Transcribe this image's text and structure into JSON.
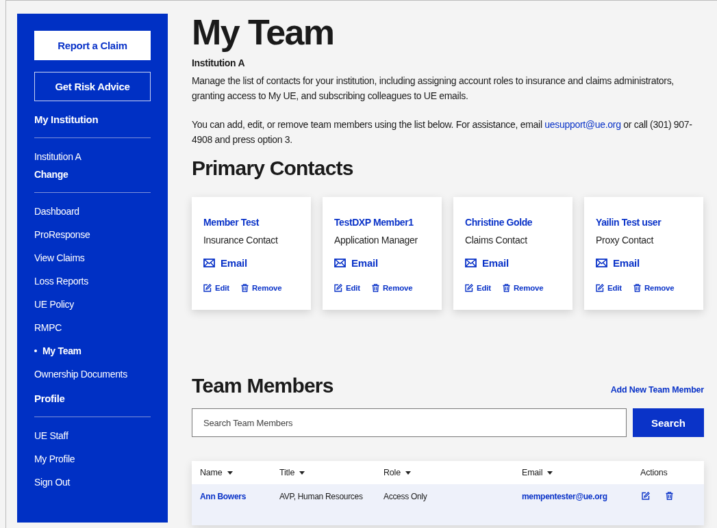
{
  "sidebar": {
    "buttons": [
      {
        "label": "Report a Claim",
        "kind": "filled"
      },
      {
        "label": "Get Risk Advice",
        "kind": "outline"
      }
    ],
    "institution_heading": "My Institution",
    "institution": {
      "name": "Institution A",
      "change_link": "Change"
    },
    "nav_items": [
      {
        "label": "Dashboard",
        "selected": false
      },
      {
        "label": "ProResponse",
        "selected": false
      },
      {
        "label": "View Claims",
        "selected": false
      },
      {
        "label": "Loss Reports",
        "selected": false
      },
      {
        "label": "UE Policy",
        "selected": false
      },
      {
        "label": "RMPC",
        "selected": false
      },
      {
        "label": "My Team",
        "selected": true
      },
      {
        "label": "Ownership Documents",
        "selected": false
      }
    ],
    "profile_heading": "Profile",
    "profile_items": [
      {
        "label": "UE Staff"
      },
      {
        "label": "My Profile"
      },
      {
        "label": "Sign Out"
      }
    ]
  },
  "page": {
    "title": "My Team",
    "institution": "Institution A",
    "paragraphs": [
      {
        "text": "Manage the list of contacts for your institution, including assigning account roles to insurance and claims administrators, granting access to My UE, and subscribing colleagues to UE emails."
      },
      {
        "text_before": "You can add, edit, or remove team members using the list below. For assistance, email ",
        "link": "uesupport@ue.org",
        "text_after": " or call (301) 907-4908 and press option 3."
      }
    ]
  },
  "primary_contacts": {
    "heading": "Primary Contacts",
    "cards": [
      {
        "name": "Member Test",
        "role": "Insurance Contact",
        "email_link": "Email",
        "edit": "Edit",
        "remove": "Remove"
      },
      {
        "name": "TestDXP Member1",
        "role": "Application Manager",
        "email_link": "Email",
        "edit": "Edit",
        "remove": "Remove"
      },
      {
        "name": "Christine Golde",
        "role": "Claims Contact",
        "email_link": "Email",
        "edit": "Edit",
        "remove": "Remove"
      },
      {
        "name": "Yailin Test user",
        "role": "Proxy Contact",
        "email_link": "Email",
        "edit": "Edit",
        "remove": "Remove"
      }
    ]
  },
  "team_members": {
    "heading": "Team Members",
    "add_link": "Add New Team Member",
    "search": {
      "placeholder": "Search Team Members",
      "button": "Search"
    },
    "table": {
      "columns": [
        {
          "label": "Name",
          "sortable": true
        },
        {
          "label": "Title",
          "sortable": true
        },
        {
          "label": "Role",
          "sortable": true
        },
        {
          "label": "Email",
          "sortable": true
        },
        {
          "label": "Actions",
          "sortable": false
        }
      ],
      "rows": [
        {
          "name": "Ann Bowers",
          "title": "AVP, Human Resources",
          "role": "Access Only",
          "email": "mempentester@ue.org",
          "selected": true
        }
      ]
    }
  }
}
